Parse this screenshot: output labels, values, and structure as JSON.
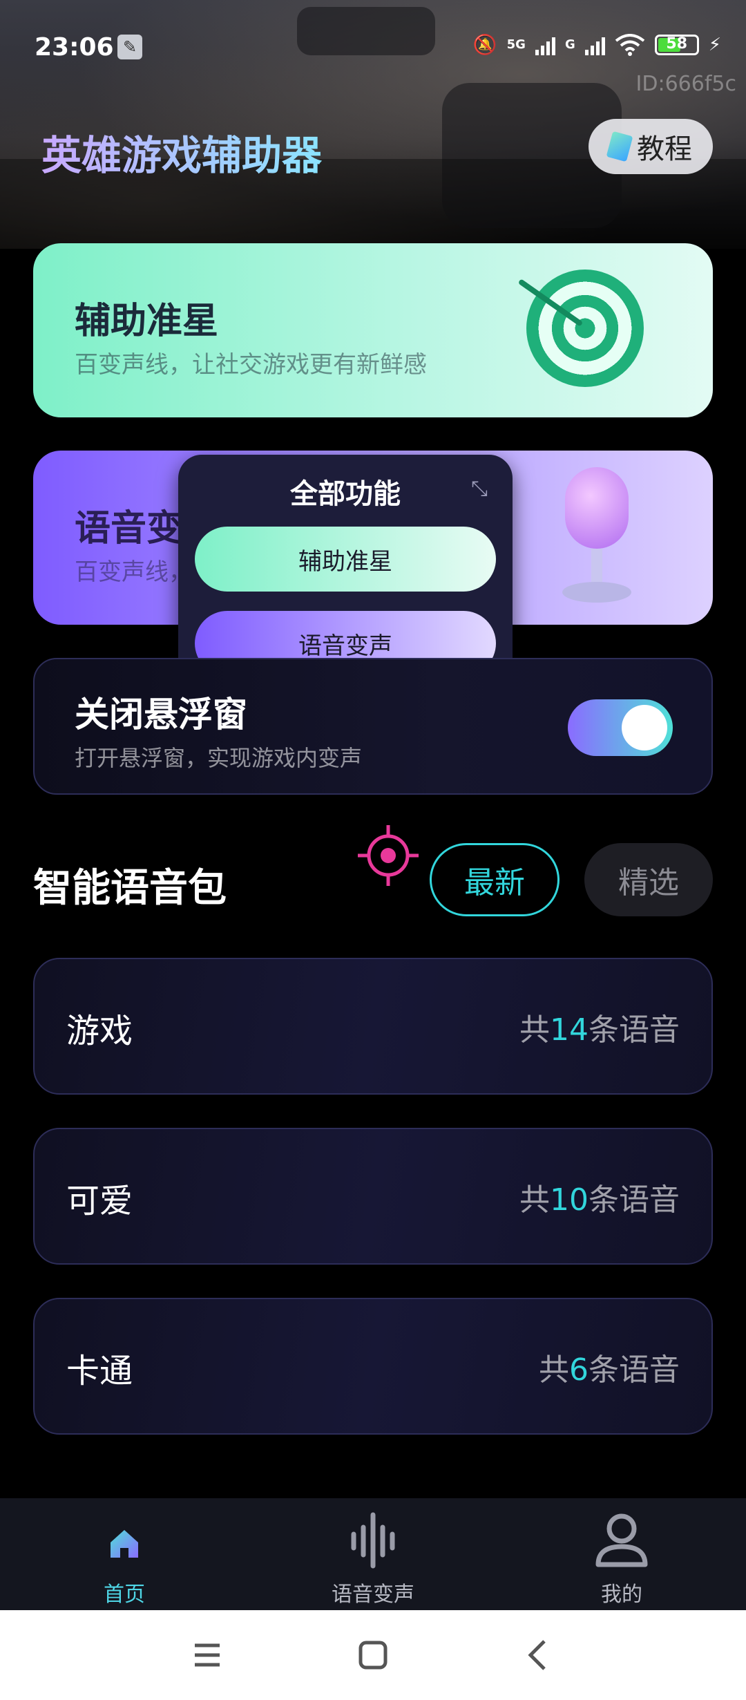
{
  "status_bar": {
    "time": "23:06",
    "network_1": "5G",
    "network_2": "G",
    "battery": "58"
  },
  "device_id": "ID:666f5c",
  "header": {
    "title": "英雄游戏辅助器",
    "tutorial_label": "教程"
  },
  "cards": {
    "aim": {
      "title": "辅助准星",
      "subtitle": "百变声线，让社交游戏更有新鲜感"
    },
    "voice": {
      "title": "语音变声",
      "subtitle": "百变声线，让社交游戏更有新鲜感"
    }
  },
  "popup": {
    "title": "全部功能",
    "aim_label": "辅助准星",
    "voice_label": "语音变声"
  },
  "float_window": {
    "title": "关闭悬浮窗",
    "subtitle": "打开悬浮窗，实现游戏内变声",
    "enabled": true
  },
  "voice_section": {
    "title": "智能语音包",
    "filter_latest": "最新",
    "filter_featured": "精选",
    "count_prefix": "共",
    "count_suffix": "条语音",
    "packs": [
      {
        "name": "游戏",
        "count": "14"
      },
      {
        "name": "可爱",
        "count": "10"
      },
      {
        "name": "卡通",
        "count": "6"
      }
    ]
  },
  "bottom_nav": {
    "home": "首页",
    "voice_change": "语音变声",
    "mine": "我的"
  },
  "colors": {
    "accent_cyan": "#32d6dc",
    "aim_green": "#7ef0c8",
    "voice_purple": "#7f5cff",
    "crosshair_pink": "#e8399a"
  }
}
